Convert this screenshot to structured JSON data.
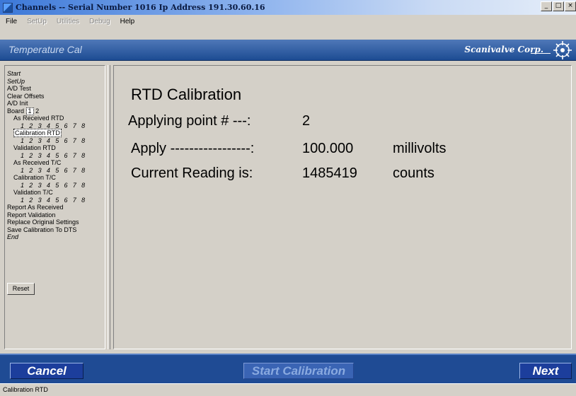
{
  "window": {
    "title": "Channels -- Serial Number 1016 Ip Address 191.30.60.16",
    "controls": [
      "_",
      "□",
      "×"
    ]
  },
  "menu": [
    "File",
    "SetUp",
    "Utilities",
    "Debug",
    "Help"
  ],
  "header": {
    "title": "Temperature Cal",
    "brand": "Scanivalve Corp."
  },
  "sidebar": {
    "start": "Start",
    "setup": "SetUp",
    "ad_test": "A/D Test",
    "clear_offsets": "Clear Offsets",
    "ad_init": "A/D Init",
    "board_label": "Board",
    "board_selected": "1",
    "board_other": "2",
    "sections": [
      {
        "label": "As Received RTD",
        "channels": "1 2 3 4 5 6 7 8"
      },
      {
        "label": "Calibration RTD",
        "channels": "1 2 3 4 5 6 7 8"
      },
      {
        "label": "Validation RTD",
        "channels": "1 2 3 4 5 6 7 8"
      },
      {
        "label": "As Received T/C",
        "channels": "1 2 3 4 5 6 7 8"
      },
      {
        "label": "Calibration T/C",
        "channels": "1 2 3 4 5 6 7 8"
      },
      {
        "label": "Validation T/C",
        "channels": "1 2 3 4 5 6 7 8"
      }
    ],
    "report_as_received": "Report As Received",
    "report_validation": "Report Validation",
    "replace_original": "Replace Original Settings",
    "save_calibration": "Save Calibration To DTS",
    "end": "End",
    "reset": "Reset"
  },
  "main": {
    "heading": "RTD Calibration",
    "point_label": "Applying point # ---:",
    "point_value": "2",
    "apply_label": "Apply -----------------:",
    "apply_value": "100.000",
    "apply_unit": "millivolts",
    "reading_label": "Current Reading is:",
    "reading_value": "1485419",
    "reading_unit": "counts"
  },
  "buttons": {
    "cancel": "Cancel",
    "start": "Start Calibration",
    "next": "Next"
  },
  "status": "Calibration RTD",
  "colors": {
    "header_blue": "#1d4c93",
    "button_blue": "#1c3e9c",
    "face": "#d4d0c8"
  },
  "icons": [
    "app-icon",
    "scanivalve-logo-icon",
    "minimize-icon",
    "maximize-icon",
    "close-icon"
  ]
}
